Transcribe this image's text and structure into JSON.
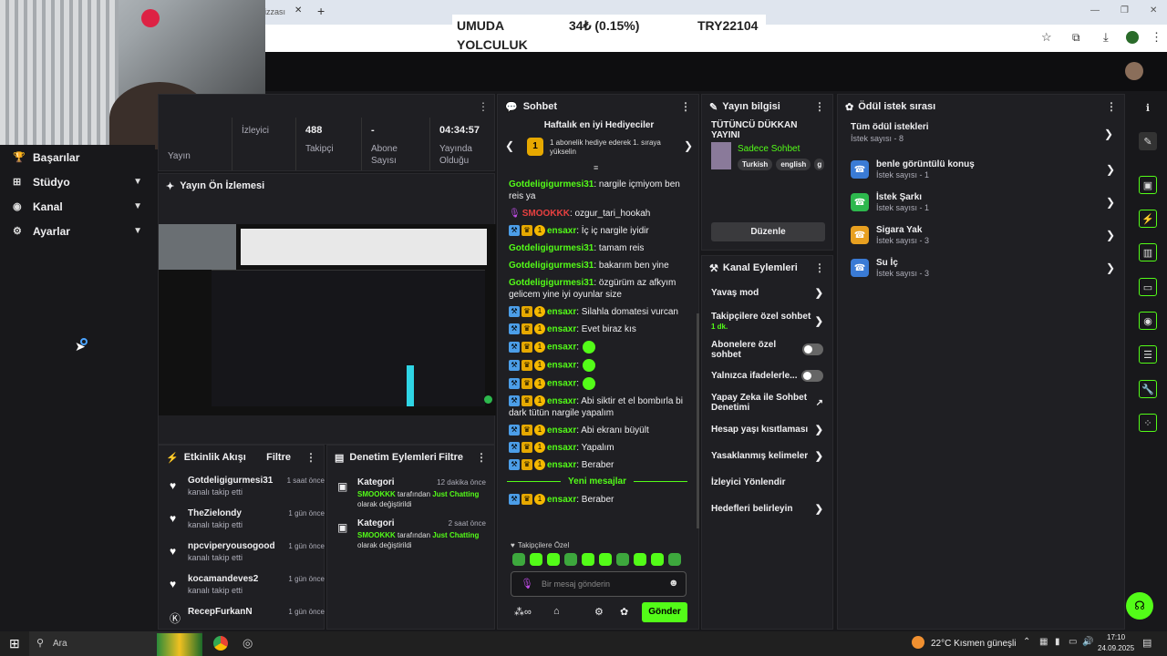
{
  "browser": {
    "tab_partial": "izzası",
    "new_tab": "+",
    "ticker_name_1": "UMUDA",
    "ticker_name_2": "YOLCULUK",
    "ticker_change": "34₺ (0.15%)",
    "ticker_total": "TRY22104"
  },
  "sidebar": {
    "items": [
      {
        "label": "Başarılar",
        "icon": "trophy-icon"
      },
      {
        "label": "Stüdyo",
        "icon": "studio-icon"
      },
      {
        "label": "Kanal",
        "icon": "channel-icon"
      },
      {
        "label": "Ayarlar",
        "icon": "gear-icon"
      }
    ]
  },
  "stats": {
    "viewers_label": "Yayın",
    "viewers_label2": "İzleyici",
    "followers_value": "488",
    "followers_label": "Takipçi",
    "subs_value": "-",
    "subs_label": "Abone Sayısı",
    "uptime_value": "04:34:57",
    "uptime_label": "Yayında Olduğu"
  },
  "preview": {
    "title": "Yayın Ön İzlemesi"
  },
  "activity": {
    "title": "Etkinlik Akışı",
    "filter": "Filtre",
    "items": [
      {
        "name": "Gotdeligigurmesi31",
        "desc": "kanalı takip etti",
        "time": "1 saat önce"
      },
      {
        "name": "TheZielondy",
        "desc": "kanalı takip etti",
        "time": "1 gün önce"
      },
      {
        "name": "npcviperyousogood",
        "desc": "kanalı takip etti",
        "time": "1 gün önce"
      },
      {
        "name": "kocamandeves2",
        "desc": "kanalı takip etti",
        "time": "1 gün önce"
      },
      {
        "name": "RecepFurkanN",
        "desc": "",
        "time": "1 gün önce"
      }
    ]
  },
  "moderation": {
    "title": "Denetim Eylemleri",
    "filter": "Filtre",
    "items": [
      {
        "title": "Kategori",
        "time": "12 dakika önce",
        "user": "SMOOKKK",
        "mid": " tarafından ",
        "cat": "Just Chatting",
        "end": "olarak değiştirildi"
      },
      {
        "title": "Kategori",
        "time": "2 saat önce",
        "user": "SMOOKKK",
        "mid": " tarafından ",
        "cat": "Just Chatting",
        "end": "olarak değiştirildi"
      }
    ]
  },
  "chat": {
    "title": "Sohbet",
    "gifters_title": "Haftalık en iyi Hediyeciler",
    "gifters_text": "1 abonelik hediye ederek 1. sıraya yükselin",
    "gifters_rank": "1",
    "lines": [
      {
        "user": "Gotdeligigurmesi31",
        "text": ": nargile içmiyom ben reis ya",
        "badges": 0
      },
      {
        "user": "SMOOKKK",
        "text": ": ozgur_tari_hookah",
        "badges": 0,
        "mic": true
      },
      {
        "user": "ensaxr",
        "text": ": İç iç nargile iyidir",
        "badges": 3
      },
      {
        "user": "Gotdeligigurmesi31",
        "text": ": tamam reis",
        "badges": 0
      },
      {
        "user": "Gotdeligigurmesi31",
        "text": ": bakarım ben yine",
        "badges": 0
      },
      {
        "user": "Gotdeligigurmesi31",
        "text": ": özgürüm az afkyım gelicem yine iyi oyunlar size",
        "badges": 0
      },
      {
        "user": "ensaxr",
        "text": ": Silahla domatesi vurcan",
        "badges": 3
      },
      {
        "user": "ensaxr",
        "text": ": Evet biraz kıs",
        "badges": 3
      },
      {
        "user": "ensaxr",
        "text": ":",
        "badges": 3,
        "emote": true
      },
      {
        "user": "ensaxr",
        "text": ":",
        "badges": 3,
        "emote": true
      },
      {
        "user": "ensaxr",
        "text": ":",
        "badges": 3,
        "emote": true
      },
      {
        "user": "ensaxr",
        "text": ": Abi siktir et el bombırla bi dark tütün nargile yapalım",
        "badges": 3
      },
      {
        "user": "ensaxr",
        "text": ": Abi ekranı büyült",
        "badges": 3
      },
      {
        "user": "ensaxr",
        "text": ": Yapalım",
        "badges": 3
      },
      {
        "user": "ensaxr",
        "text": ": Beraber",
        "badges": 3
      }
    ],
    "new_messages": "Yeni mesajlar",
    "last_line": {
      "user": "ensaxr",
      "text": ": Beraber"
    },
    "followers_only": "Takipçilere Özel",
    "input_placeholder": "Bir mesaj gönderin",
    "send": "Gönder"
  },
  "stream_info": {
    "title": "Yayın bilgisi",
    "stream_title": "TÜTÜNCÜ DÜKKAN YAYINI",
    "category": "Sadece Sohbet",
    "tags": [
      "Turkish",
      "english",
      "g"
    ],
    "edit": "Düzenle"
  },
  "channel_actions": {
    "title": "Kanal Eylemleri",
    "items": [
      {
        "label": "Yavaş mod",
        "type": "chev"
      },
      {
        "label": "Takipçilere özel sohbet",
        "sub": "1 dk.",
        "type": "chev"
      },
      {
        "label": "Abonelere özel sohbet",
        "type": "toggle"
      },
      {
        "label": "Yalnızca ifadelerle...",
        "type": "toggle"
      },
      {
        "label": "Yapay Zeka ile Sohbet Denetimi",
        "type": "ext"
      },
      {
        "label": "Hesap yaşı kısıtlaması",
        "type": "chev"
      },
      {
        "label": "Yasaklanmış kelimeler",
        "type": "chev"
      },
      {
        "label": "İzleyici Yönlendir",
        "type": "none"
      },
      {
        "label": "Hedefleri belirleyin",
        "type": "chev"
      }
    ]
  },
  "rewards": {
    "title": "Ödül istek sırası",
    "all_title": "Tüm ödül istekleri",
    "all_count": "İstek sayısı - 8",
    "items": [
      {
        "title": "benle görüntülü konuş",
        "count": "İstek sayısı - 1",
        "color": "#3a7bd5"
      },
      {
        "title": "İstek Şarkı",
        "count": "İstek sayısı - 1",
        "color": "#2db84d"
      },
      {
        "title": "Sigara Yak",
        "count": "İstek sayısı - 3",
        "color": "#e8a020"
      },
      {
        "title": "Su İç",
        "count": "İstek sayısı - 3",
        "color": "#3a7bd5"
      }
    ]
  },
  "taskbar": {
    "search": "Ara",
    "weather": "22°C  Kısmen güneşli",
    "time": "17:10",
    "date": "24.09.2025"
  },
  "colors": {
    "accent": "#53fc18",
    "bg": "#18181b",
    "panel": "#1f1f23"
  }
}
